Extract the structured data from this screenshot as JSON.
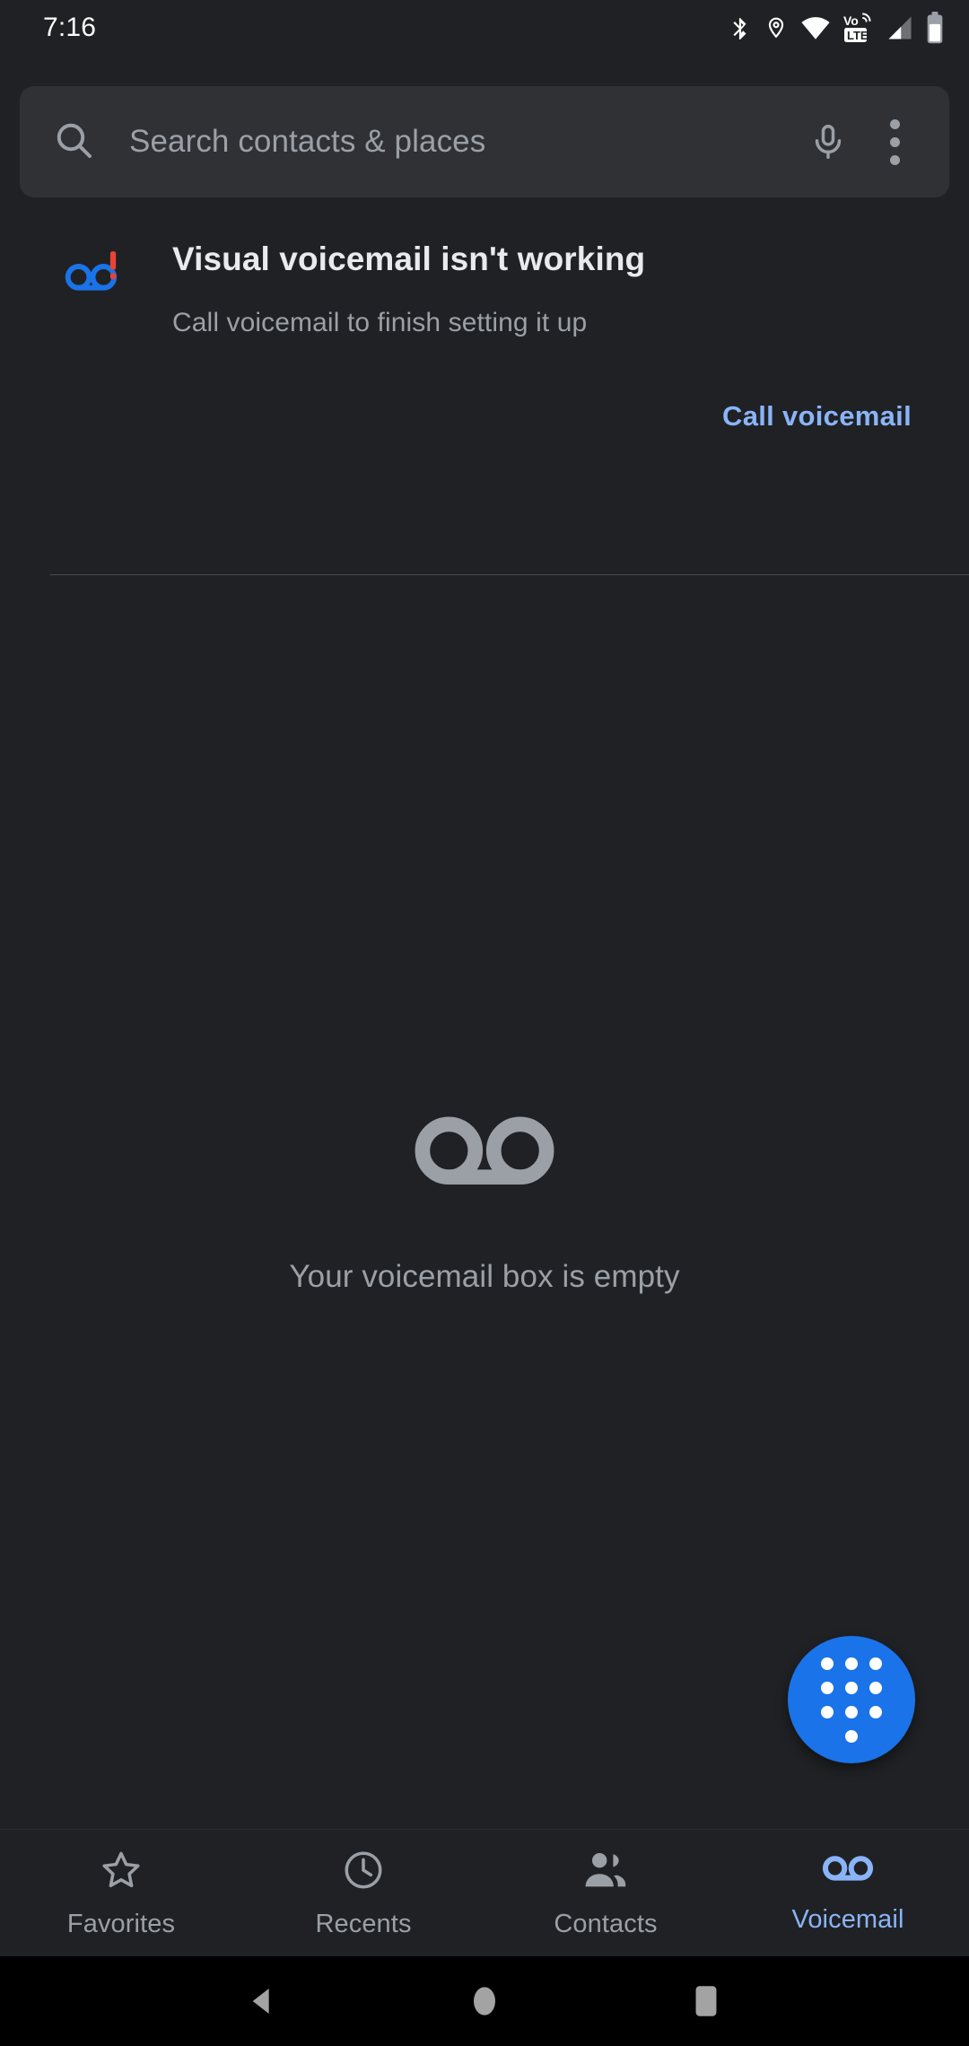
{
  "status_bar": {
    "time": "7:16",
    "icons": [
      {
        "name": "bluetooth-icon",
        "label": "Bluetooth"
      },
      {
        "name": "location-icon",
        "label": "Location"
      },
      {
        "name": "wifi-icon",
        "label": "Wi-Fi"
      },
      {
        "name": "volte-icon",
        "label": "VoLTE"
      },
      {
        "name": "cellular-signal-icon",
        "label": "Mobile signal"
      },
      {
        "name": "battery-icon",
        "label": "Battery"
      }
    ]
  },
  "search": {
    "placeholder": "Search contacts & places",
    "search_icon": "search-icon",
    "voice_icon": "microphone-icon",
    "overflow_icon": "overflow-menu-icon"
  },
  "alert": {
    "icon": "voicemail-error-icon",
    "title": "Visual voicemail isn't working",
    "subtitle": "Call voicemail to finish setting it up",
    "action_label": "Call voicemail",
    "action_color": "#8ab4f8",
    "badge_color": "#ea4335",
    "icon_color": "#1a73e8"
  },
  "empty_state": {
    "icon": "voicemail-icon",
    "message": "Your voicemail box is empty"
  },
  "fab": {
    "icon": "dialpad-icon",
    "label": "Dialpad",
    "color": "#1a73e8"
  },
  "bottom_nav": {
    "active_color": "#8ab4f8",
    "inactive_color": "#9aa0a6",
    "items": [
      {
        "label": "Favorites",
        "icon": "star-icon",
        "active": false
      },
      {
        "label": "Recents",
        "icon": "clock-icon",
        "active": false
      },
      {
        "label": "Contacts",
        "icon": "people-icon",
        "active": false
      },
      {
        "label": "Voicemail",
        "icon": "voicemail-icon",
        "active": true
      }
    ]
  },
  "system_nav": {
    "back": "back-triangle-icon",
    "home": "home-circle-icon",
    "recents": "recents-square-icon"
  }
}
